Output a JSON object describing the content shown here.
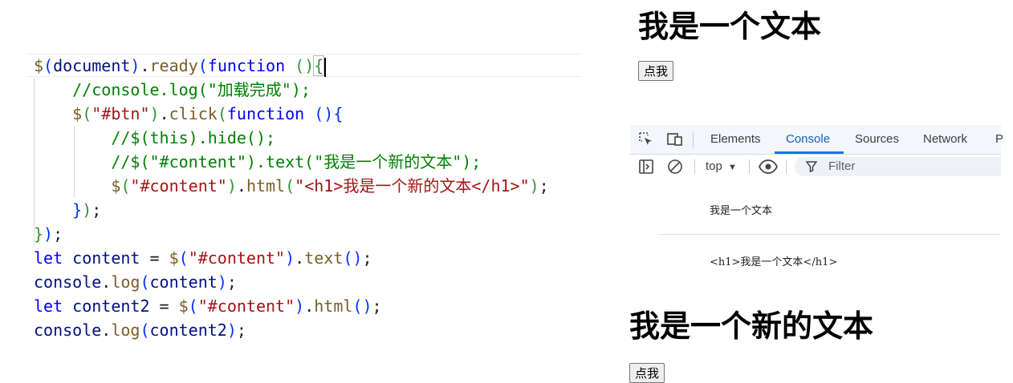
{
  "editor": {
    "lines": [
      [
        [
          "k-fn",
          "$"
        ],
        [
          "k-br1",
          "("
        ],
        [
          "k-var",
          "document"
        ],
        [
          "k-br1",
          ")"
        ],
        [
          "k-pl",
          "."
        ],
        [
          "k-fn",
          "ready"
        ],
        [
          "k-br1",
          "("
        ],
        [
          "k-kw",
          "function"
        ],
        [
          "k-pl",
          " "
        ],
        [
          "k-br2",
          "()"
        ],
        [
          "k-br2",
          "{"
        ]
      ],
      [
        [
          "k-pl",
          "    "
        ],
        [
          "k-cm",
          "//console.log(\"加载完成\");"
        ]
      ],
      [
        [
          "k-pl",
          "    "
        ],
        [
          "k-fn",
          "$"
        ],
        [
          "k-br2",
          "("
        ],
        [
          "k-str",
          "\"#btn\""
        ],
        [
          "k-br2",
          ")"
        ],
        [
          "k-pl",
          "."
        ],
        [
          "k-fn",
          "click"
        ],
        [
          "k-br2",
          "("
        ],
        [
          "k-kw",
          "function"
        ],
        [
          "k-pl",
          " "
        ],
        [
          "k-br1",
          "()"
        ],
        [
          "k-br1",
          "{"
        ]
      ],
      [
        [
          "k-pl",
          "        "
        ],
        [
          "k-cm",
          "//$(this).hide();"
        ]
      ],
      [
        [
          "k-pl",
          "        "
        ],
        [
          "k-cm",
          "//$(\"#content\").text(\"我是一个新的文本\");"
        ]
      ],
      [
        [
          "k-pl",
          "        "
        ],
        [
          "k-fn",
          "$"
        ],
        [
          "k-br2",
          "("
        ],
        [
          "k-str",
          "\"#content\""
        ],
        [
          "k-br2",
          ")"
        ],
        [
          "k-pl",
          "."
        ],
        [
          "k-fn",
          "html"
        ],
        [
          "k-br2",
          "("
        ],
        [
          "k-str",
          "\"<h1>我是一个新的文本</h1>\""
        ],
        [
          "k-br2",
          ")"
        ],
        [
          "k-pl",
          ";"
        ]
      ],
      [
        [
          "k-pl",
          "    "
        ],
        [
          "k-br1",
          "}"
        ],
        [
          "k-br2",
          ")"
        ],
        [
          "k-pl",
          ";"
        ]
      ],
      [
        [
          "k-br2",
          "}"
        ],
        [
          "k-br1",
          ")"
        ],
        [
          "k-pl",
          ";"
        ]
      ],
      [
        [
          "k-kw",
          "let"
        ],
        [
          "k-pl",
          " "
        ],
        [
          "k-var",
          "content"
        ],
        [
          "k-pl",
          " = "
        ],
        [
          "k-fn",
          "$"
        ],
        [
          "k-br1",
          "("
        ],
        [
          "k-str",
          "\"#content\""
        ],
        [
          "k-br1",
          ")"
        ],
        [
          "k-pl",
          "."
        ],
        [
          "k-fn",
          "text"
        ],
        [
          "k-br1",
          "()"
        ],
        [
          "k-pl",
          ";"
        ]
      ],
      [
        [
          "k-var",
          "console"
        ],
        [
          "k-pl",
          "."
        ],
        [
          "k-fn",
          "log"
        ],
        [
          "k-br1",
          "("
        ],
        [
          "k-var",
          "content"
        ],
        [
          "k-br1",
          ")"
        ],
        [
          "k-pl",
          ";"
        ]
      ],
      [
        [
          "k-kw",
          "let"
        ],
        [
          "k-pl",
          " "
        ],
        [
          "k-var",
          "content2"
        ],
        [
          "k-pl",
          " = "
        ],
        [
          "k-fn",
          "$"
        ],
        [
          "k-br1",
          "("
        ],
        [
          "k-str",
          "\"#content\""
        ],
        [
          "k-br1",
          ")"
        ],
        [
          "k-pl",
          "."
        ],
        [
          "k-fn",
          "html"
        ],
        [
          "k-br1",
          "()"
        ],
        [
          "k-pl",
          ";"
        ]
      ],
      [
        [
          "k-var",
          "console"
        ],
        [
          "k-pl",
          "."
        ],
        [
          "k-fn",
          "log"
        ],
        [
          "k-br1",
          "("
        ],
        [
          "k-var",
          "content2"
        ],
        [
          "k-br1",
          ")"
        ],
        [
          "k-pl",
          ";"
        ]
      ]
    ]
  },
  "page_top": {
    "heading": "我是一个文本",
    "button_label": "点我"
  },
  "devtools": {
    "tabs": [
      "Elements",
      "Console",
      "Sources",
      "Network",
      "P"
    ],
    "active_tab": "Console",
    "context": "top",
    "filter_placeholder": "Filter",
    "messages": [
      "我是一个文本",
      "<h1>我是一个文本</h1>"
    ]
  },
  "page_bottom": {
    "heading": "我是一个新的文本",
    "button_label": "点我"
  },
  "colors": {
    "keyword": "#0000ff",
    "function": "#795e26",
    "comment": "#008000",
    "string": "#a31515",
    "variable": "#001080",
    "devtools_accent": "#1a73e8"
  }
}
